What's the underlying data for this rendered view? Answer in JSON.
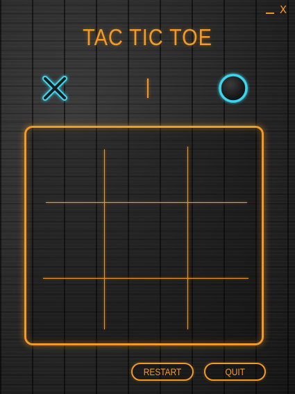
{
  "window": {
    "minimize_label": "",
    "close_label": "X"
  },
  "title": "TAC TIC TOE",
  "players": {
    "x_icon": "x-mark-icon",
    "o_icon": "o-ring-icon"
  },
  "board": {
    "cells": [
      "",
      "",
      "",
      "",
      "",
      "",
      "",
      "",
      ""
    ]
  },
  "actions": {
    "restart_label": "RESTART",
    "quit_label": "QUIT"
  },
  "colors": {
    "accent": "#f39a26",
    "player_glow": "#3ad6ee",
    "background": "#262626"
  }
}
